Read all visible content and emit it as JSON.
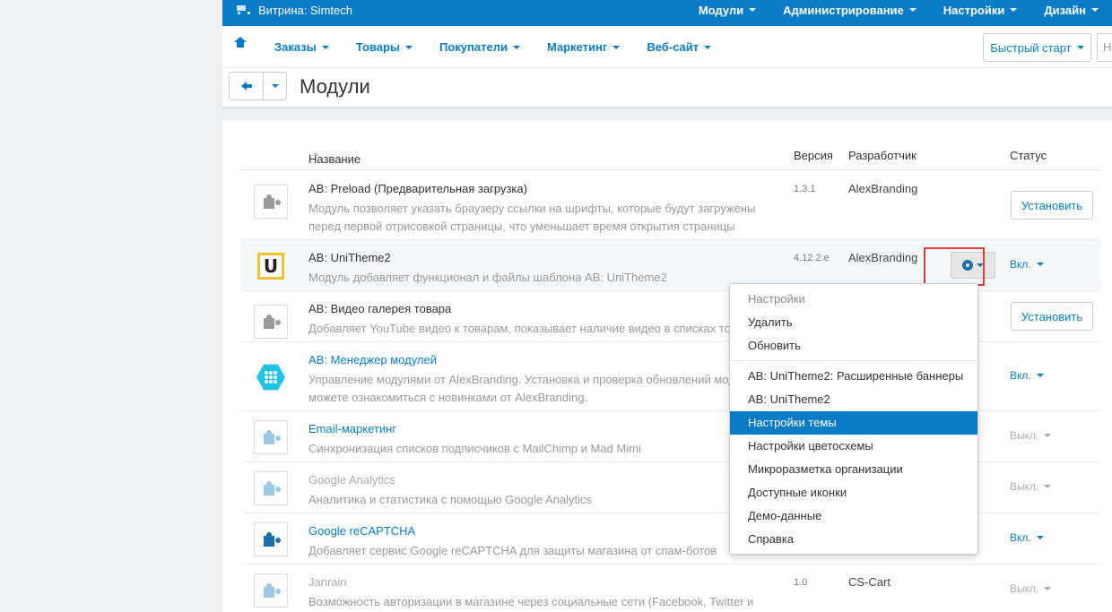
{
  "topbar": {
    "store_label": "Витрина: Simtech",
    "nav": [
      "Модули",
      "Администрирование",
      "Настройки",
      "Дизайн"
    ]
  },
  "nav2": {
    "items": [
      "Заказы",
      "Товары",
      "Покупатели",
      "Маркетинг",
      "Веб-сайт"
    ],
    "quick_start": "Быстрый старт",
    "search_placeholder": "Н"
  },
  "page": {
    "title": "Модули"
  },
  "table": {
    "columns": {
      "name": "Название",
      "version": "Версия",
      "developer": "Разработчик",
      "status": "Статус"
    },
    "rows": [
      {
        "name": "AB: Preload (Предварительная загрузка)",
        "desc": "Модуль позволяет указать браузеру ссылки на шрифты, которые будут загружены перед первой отрисовкой страницы, что уменьшает время открытия страницы",
        "version": "1.3.1",
        "developer": "AlexBranding",
        "action": "Установить"
      },
      {
        "name": "AB: UniTheme2",
        "desc": "Модуль добавляет функционал и файлы шаблона AB: UniTheme2",
        "version": "4.12.2.e",
        "developer": "AlexBranding",
        "status": "Вкл."
      },
      {
        "name": "AB: Видео галерея товара",
        "desc": "Добавляет YouTube видео к товарам, показывает наличие видео в списках тов",
        "action": "Установить"
      },
      {
        "name": "AB: Менеджер модулей",
        "desc": "Управление модулями от AlexBranding. Установка и проверка обновлений мод также можете ознакомиться с новинками от AlexBranding.",
        "status": "Вкл."
      },
      {
        "name": "Email-маркетинг",
        "desc": "Синхронизация списков подписчиков с MailChimp и Mad Mimi",
        "status": "Выкл."
      },
      {
        "name": "Google Analytics",
        "desc": "Аналитика и статистика с помощью Google Analytics",
        "status": "Выкл."
      },
      {
        "name": "Google reCAPTCHA",
        "desc": "Добавляет сервис Google reCAPTCHA для защиты магазина от спам-ботов",
        "status": "Вкл."
      },
      {
        "name": "Janrain",
        "desc": "Возможность авторизации в магазине через социальные сети (Facebook, Twitter и т.д.)",
        "version": "1.0",
        "developer": "CS-Cart",
        "status": "Выкл."
      }
    ]
  },
  "logo_letter": "U",
  "dropdown": {
    "header": "Настройки",
    "group1": [
      "Удалить",
      "Обновить"
    ],
    "group2": [
      "AB: UniTheme2: Расширенные баннеры",
      "AB: UniTheme2",
      "Настройки темы",
      "Настройки цветосхемы",
      "Микроразметка организации",
      "Доступные иконки",
      "Демо-данные",
      "Справка"
    ],
    "active": "Настройки темы"
  },
  "colors": {
    "accent": "#0a7cc7",
    "annotation": "#e53935"
  }
}
